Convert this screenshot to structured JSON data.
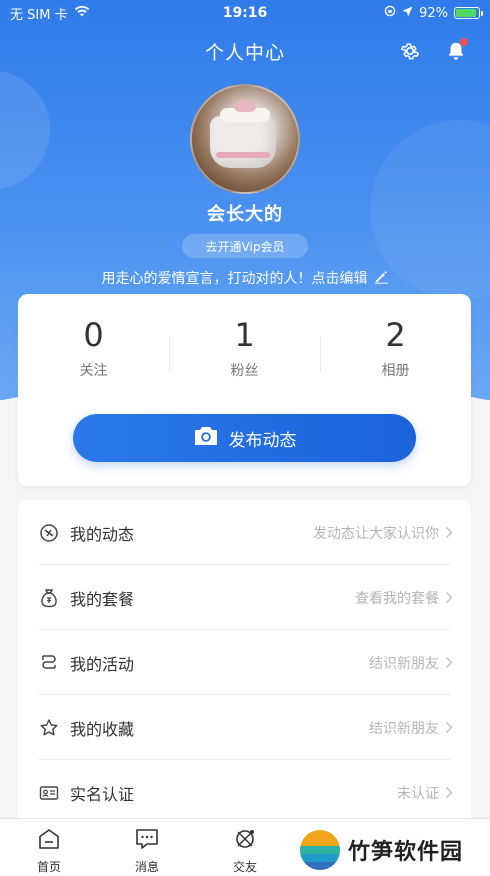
{
  "status_bar": {
    "carrier": "无 SIM 卡",
    "time": "19:16",
    "battery_percent": "92%",
    "battery_level": 0.92
  },
  "header": {
    "title": "个人中心",
    "settings_icon": "gear-icon",
    "notification_icon": "bell-icon"
  },
  "profile": {
    "username": "会长大的",
    "vip_label": "去开通Vip会员",
    "bio": "用走心的爱情宣言，打动对的人！点击编辑"
  },
  "stats": [
    {
      "value": "0",
      "label": "关注"
    },
    {
      "value": "1",
      "label": "粉丝"
    },
    {
      "value": "2",
      "label": "相册"
    }
  ],
  "publish_button": {
    "label": "发布动态",
    "icon": "camera-icon"
  },
  "menu": [
    {
      "title": "我的动态",
      "hint": "发动态让大家认识你",
      "icon": "moment-icon"
    },
    {
      "title": "我的套餐",
      "hint": "查看我的套餐",
      "icon": "money-bag-icon"
    },
    {
      "title": "我的活动",
      "hint": "结识新朋友",
      "icon": "activity-icon"
    },
    {
      "title": "我的收藏",
      "hint": "结识新朋友",
      "icon": "star-icon"
    },
    {
      "title": "实名认证",
      "hint": "未认证",
      "icon": "id-card-icon"
    }
  ],
  "tabbar": [
    {
      "label": "首页",
      "icon": "home-icon"
    },
    {
      "label": "消息",
      "icon": "message-icon"
    },
    {
      "label": "交友",
      "icon": "compass-icon"
    }
  ],
  "watermark": {
    "text": "竹笋软件园"
  },
  "colors": {
    "primary": "#2a79ea",
    "hero_top": "#2f7bea",
    "hint": "#b5b5b5",
    "badge": "#ff4d4f"
  }
}
